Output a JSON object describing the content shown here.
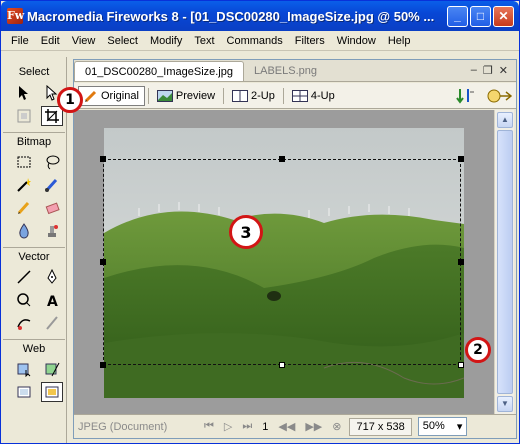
{
  "window": {
    "title": "Macromedia Fireworks 8 - [01_DSC00280_ImageSize.jpg @  50% ...",
    "app_icon": "Fw",
    "minimize": "_",
    "maximize": "□",
    "close": "✕"
  },
  "menu": [
    "File",
    "Edit",
    "View",
    "Select",
    "Modify",
    "Text",
    "Commands",
    "Filters",
    "Window",
    "Help"
  ],
  "tools": {
    "select_title": "Select",
    "bitmap_title": "Bitmap",
    "vector_title": "Vector",
    "web_title": "Web"
  },
  "document": {
    "tabs": [
      {
        "label": "01_DSC00280_ImageSize.jpg"
      },
      {
        "label": "LABELS.png"
      }
    ],
    "doc_min": "–",
    "doc_restore": "❐",
    "doc_close": "✕",
    "views": [
      "Original",
      "Preview",
      "2-Up",
      "4-Up"
    ],
    "status": {
      "doc_label": "JPEG (Document)",
      "frame": "1",
      "size": "717 x 538",
      "zoom": "50%",
      "zoom_arrow": "▾"
    }
  },
  "callouts": [
    "1",
    "2",
    "3"
  ],
  "colors": {
    "callout_border": "#d21515",
    "title_bar": "#0a5fe9"
  }
}
